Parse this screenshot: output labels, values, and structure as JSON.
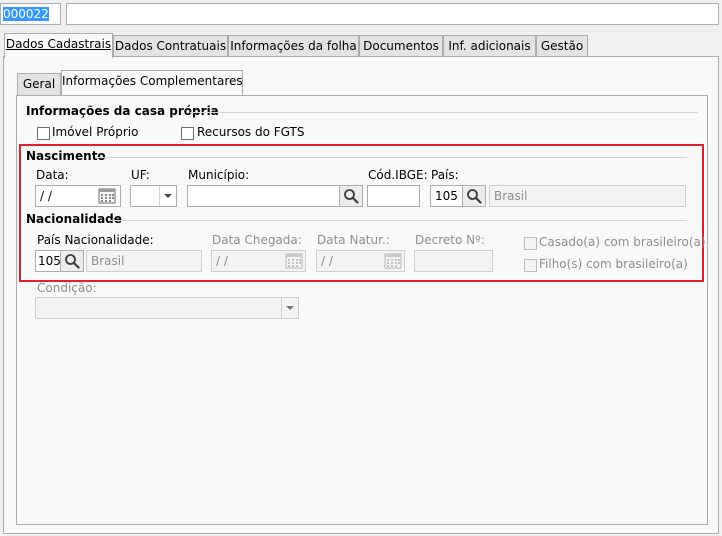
{
  "header": {
    "code_value": "000022",
    "name_value": ""
  },
  "main_tabs": [
    {
      "label": "Dados Cadastrais"
    },
    {
      "label": "Dados Contratuais"
    },
    {
      "label": "Informações da folha"
    },
    {
      "label": "Documentos"
    },
    {
      "label": "Inf. adicionais"
    },
    {
      "label": "Gestão"
    }
  ],
  "sub_tabs": [
    {
      "label": "Geral"
    },
    {
      "label": "Informações Complementares"
    }
  ],
  "casa_propria": {
    "title": "Informações da casa própria",
    "imovel_proprio_label": "Imóvel Próprio",
    "recursos_fgts_label": "Recursos do FGTS"
  },
  "nascimento": {
    "title": "Nascimento",
    "data_label": "Data:",
    "data_value": " /  /",
    "uf_label": "UF:",
    "uf_value": "",
    "municipio_label": "Município:",
    "municipio_value": "",
    "cod_ibge_label": "Cód.IBGE:",
    "cod_ibge_value": "",
    "pais_label": "País:",
    "pais_code": "105",
    "pais_name": "Brasil"
  },
  "nacionalidade": {
    "title": "Nacionalidade",
    "pais_nac_label": "País Nacionalidade:",
    "pais_nac_code": "105",
    "pais_nac_name": "Brasil",
    "data_chegada_label": "Data Chegada:",
    "data_chegada_value": " /  /",
    "data_natur_label": "Data Natur.:",
    "data_natur_value": " /  /",
    "decreto_label": "Decreto Nº:",
    "decreto_value": "",
    "casado_label": "Casado(a) com brasileiro(a)",
    "filhos_label": "Filho(s) com brasileiro(a)"
  },
  "condicao": {
    "label": "Condição:",
    "value": ""
  },
  "colors": {
    "highlight_border": "#e0202e",
    "selection": "#3399ff"
  }
}
